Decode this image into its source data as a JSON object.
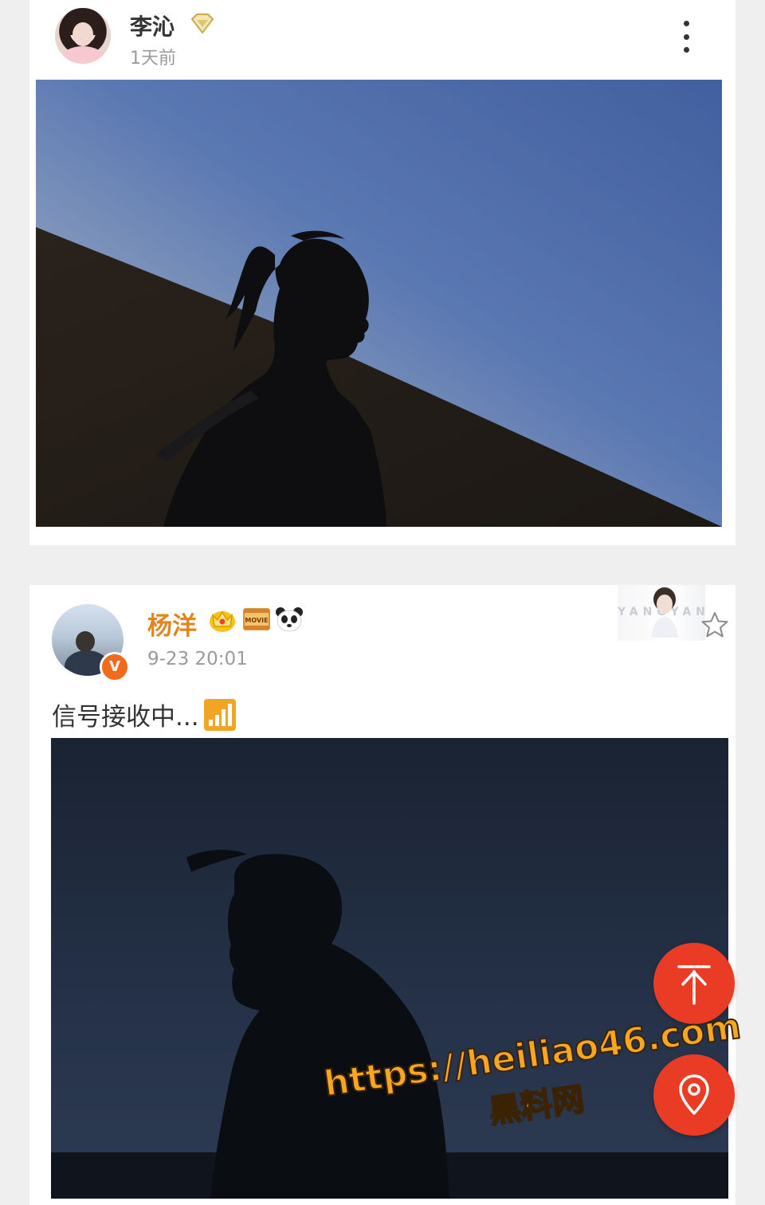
{
  "post1": {
    "user_name": "李沁",
    "time": "1天前",
    "badge_icon": "diamond-badge-icon"
  },
  "post2": {
    "user_name": "杨洋",
    "time": "9-23 20:01",
    "text": "信号接收中...",
    "verified_badge": "V",
    "badge_icons": [
      "crown-icon",
      "movie-icon",
      "panda-icon"
    ],
    "movie_label": "MOVIE",
    "banner_text": "YANGYANG"
  },
  "floating": {
    "top_icon": "arrow-up-icon",
    "location_icon": "location-pin-icon"
  },
  "watermark": {
    "url": "https://heiliao46.com",
    "name": "黑料网"
  },
  "colors": {
    "brand_orange": "#e0861f",
    "fab_red": "#ea3c24",
    "watermark": "#f5a623"
  }
}
